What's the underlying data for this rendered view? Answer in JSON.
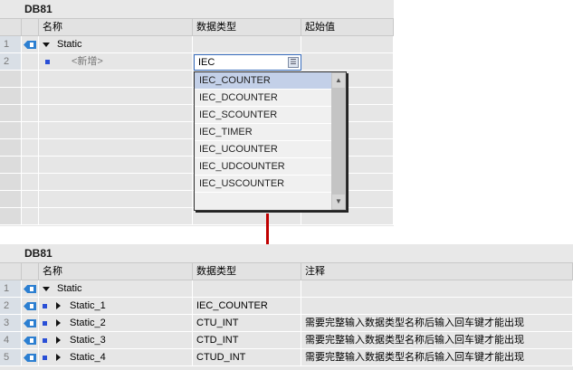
{
  "top": {
    "title": "DB81",
    "headers": {
      "name": "名称",
      "type": "数据类型",
      "start": "起始值"
    },
    "rows": [
      {
        "num": "1",
        "name": "Static",
        "type": "",
        "start": ""
      },
      {
        "num": "2",
        "name": "<新增>",
        "type": "",
        "start": ""
      }
    ],
    "input_value": "IEC",
    "dropdown": [
      "IEC_COUNTER",
      "IEC_DCOUNTER",
      "IEC_SCOUNTER",
      "IEC_TIMER",
      "IEC_UCOUNTER",
      "IEC_UDCOUNTER",
      "IEC_USCOUNTER"
    ],
    "selected": "IEC_COUNTER"
  },
  "bottom": {
    "title": "DB81",
    "headers": {
      "name": "名称",
      "type": "数据类型",
      "comment": "注释"
    },
    "rows": [
      {
        "num": "1",
        "name": "Static",
        "type": "",
        "comment": ""
      },
      {
        "num": "2",
        "name": "Static_1",
        "type": "IEC_COUNTER",
        "comment": ""
      },
      {
        "num": "3",
        "name": "Static_2",
        "type": "CTU_INT",
        "comment": "需要完整输入数据类型名称后输入回车键才能出现"
      },
      {
        "num": "4",
        "name": "Static_3",
        "type": "CTD_INT",
        "comment": "需要完整输入数据类型名称后输入回车键才能出现"
      },
      {
        "num": "5",
        "name": "Static_4",
        "type": "CTUD_INT",
        "comment": "需要完整输入数据类型名称后输入回车键才能出现"
      }
    ]
  },
  "colors": {
    "accent": "#c00000",
    "selection": "#c3d0e8"
  }
}
